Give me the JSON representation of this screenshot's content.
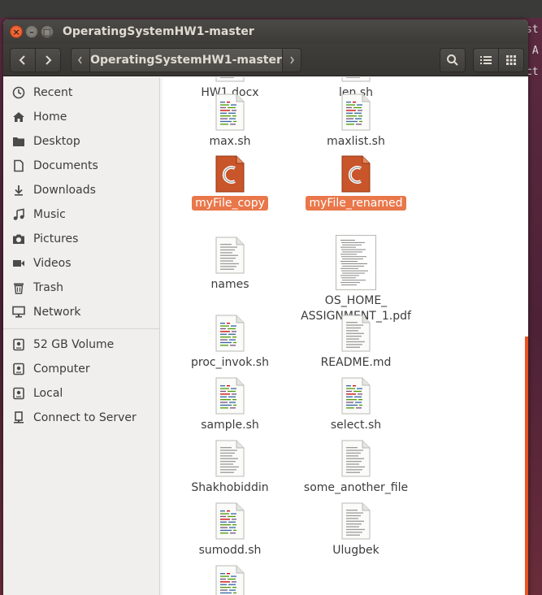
{
  "window": {
    "title": "OperatingSystemHW1-master",
    "close_glyph": "×",
    "minimize_glyph": "–",
    "maximize_glyph": "□"
  },
  "background_terminal_text": "st\n A\nct",
  "toolbar": {
    "back_icon": "chevron-left-icon",
    "forward_icon": "chevron-right-icon",
    "path_label": "OperatingSystemHW1-master",
    "search_icon": "search-icon",
    "list_view_icon": "list-view-icon",
    "grid_view_icon": "grid-view-icon"
  },
  "sidebar": {
    "items": [
      {
        "label": "Recent",
        "icon": "clock-icon"
      },
      {
        "label": "Home",
        "icon": "home-icon"
      },
      {
        "label": "Desktop",
        "icon": "folder-icon"
      },
      {
        "label": "Documents",
        "icon": "document-icon"
      },
      {
        "label": "Downloads",
        "icon": "download-icon"
      },
      {
        "label": "Music",
        "icon": "music-icon"
      },
      {
        "label": "Pictures",
        "icon": "camera-icon"
      },
      {
        "label": "Videos",
        "icon": "video-icon"
      },
      {
        "label": "Trash",
        "icon": "trash-icon"
      },
      {
        "label": "Network",
        "icon": "network-icon"
      }
    ],
    "devices": [
      {
        "label": "52 GB Volume",
        "icon": "drive-icon"
      },
      {
        "label": "Computer",
        "icon": "drive-icon"
      },
      {
        "label": "Local",
        "icon": "drive-icon"
      },
      {
        "label": "Connect to Server",
        "icon": "server-icon"
      }
    ]
  },
  "files": [
    {
      "name": "HW1.docx",
      "type": "partial"
    },
    {
      "name": "len.sh",
      "type": "partial"
    },
    {
      "name": "max.sh",
      "type": "script"
    },
    {
      "name": "maxlist.sh",
      "type": "script"
    },
    {
      "name": "myFile_copy",
      "type": "c",
      "selected": true
    },
    {
      "name": "myFile_renamed",
      "type": "c",
      "selected": true
    },
    {
      "name": "names",
      "type": "text"
    },
    {
      "name": "OS_HOME_\nASSIGNMENT_1.pdf",
      "type": "pdf"
    },
    {
      "name": "proc_invok.sh",
      "type": "script"
    },
    {
      "name": "README.md",
      "type": "text"
    },
    {
      "name": "sample.sh",
      "type": "script"
    },
    {
      "name": "select.sh",
      "type": "script"
    },
    {
      "name": "Shakhobiddin",
      "type": "text"
    },
    {
      "name": "some_another_file",
      "type": "text"
    },
    {
      "name": "sumodd.sh",
      "type": "script"
    },
    {
      "name": "Ulugbek",
      "type": "text"
    },
    {
      "name": "",
      "type": "script"
    }
  ],
  "colors": {
    "selection": "#e9774a",
    "accent": "#e95420"
  }
}
